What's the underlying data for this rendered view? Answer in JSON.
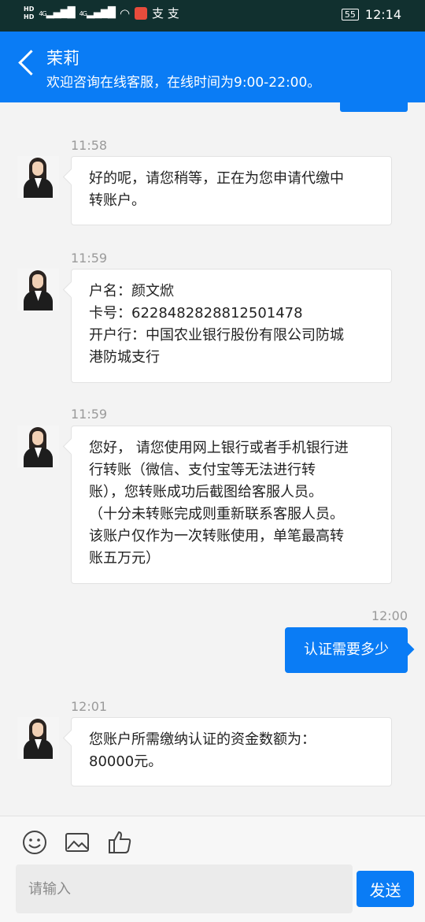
{
  "status_bar": {
    "hd1": "HD",
    "hd2": "HD",
    "net1": "4G",
    "net2": "4G",
    "extra": "支 支",
    "battery": "55",
    "time": "12:14"
  },
  "header": {
    "title": "茉莉",
    "subtitle": "欢迎咨询在线客服，在线时间为9:00-22:00。"
  },
  "messages": [
    {
      "time": "11:58",
      "text": "好的呢，请您稍等，正在为您申请代缴中\n转账户。"
    },
    {
      "time": "11:59",
      "text": "户名：颜文焮\n卡号：6228482828812501478\n开户行：中国农业银行股份有限公司防城\n港防城支行"
    },
    {
      "time": "11:59",
      "text": "您好， 请您使用网上银行或者手机银行进\n行转账（微信、支付宝等无法进行转\n账），您转账成功后截图给客服人员。\n（十分未转账完成则重新联系客服人员。\n该账户仅作为一次转账使用，单笔最高转\n账五万元）"
    },
    {
      "time": "12:01",
      "text": "您账户所需缴纳认证的资金数额为：\n80000元。"
    }
  ],
  "my_message": {
    "time": "12:00",
    "text": "认证需要多少"
  },
  "composer": {
    "placeholder": "请输入",
    "send_label": "发送",
    "tools": [
      "emoji-icon",
      "image-icon",
      "thumbs-up-icon"
    ]
  },
  "colors": {
    "accent": "#0a7cf5",
    "status_bar": "#11302f",
    "background": "#f3f3f3"
  }
}
